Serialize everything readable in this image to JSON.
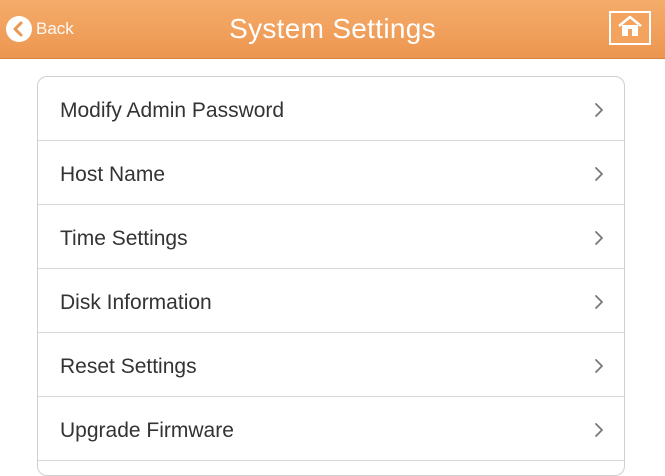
{
  "header": {
    "back_label": "Back",
    "title": "System Settings",
    "accent_color": "#ef9c58"
  },
  "menu": {
    "items": [
      {
        "label": "Modify Admin Password",
        "icon": "chevron-right-icon"
      },
      {
        "label": "Host Name",
        "icon": "chevron-right-icon"
      },
      {
        "label": "Time Settings",
        "icon": "chevron-right-icon"
      },
      {
        "label": "Disk Information",
        "icon": "chevron-right-icon"
      },
      {
        "label": "Reset Settings",
        "icon": "chevron-right-icon"
      },
      {
        "label": "Upgrade Firmware",
        "icon": "chevron-right-icon"
      }
    ]
  }
}
